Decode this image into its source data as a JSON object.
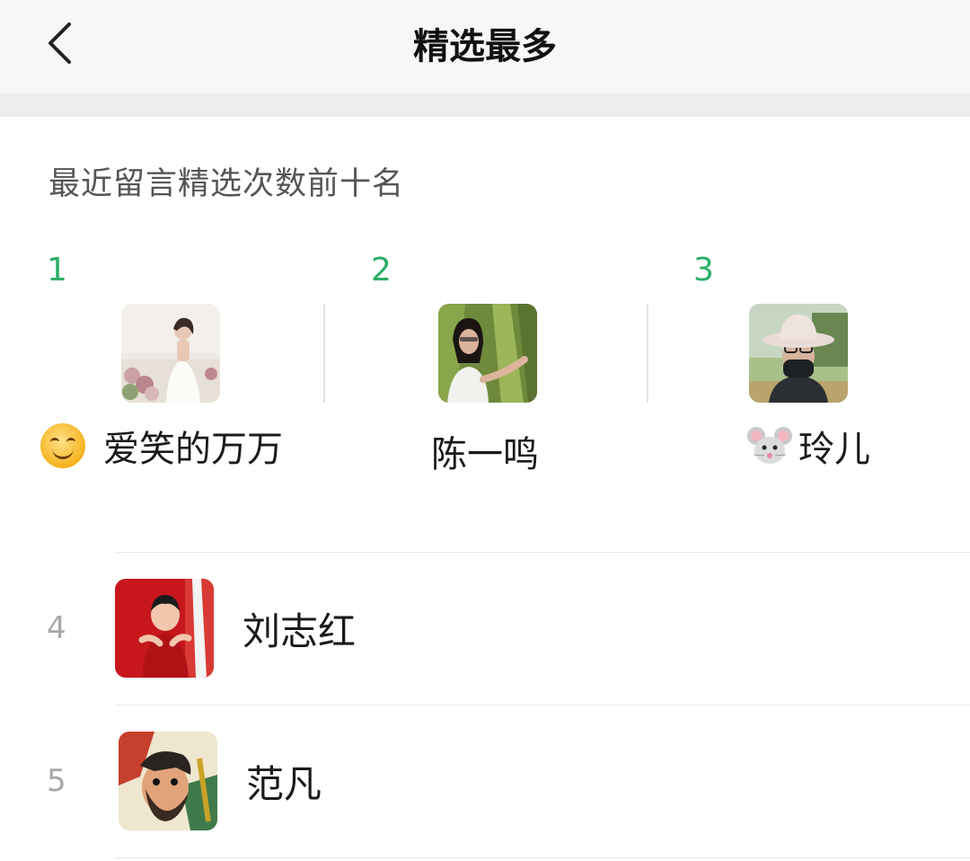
{
  "nav": {
    "title": "精选最多",
    "back_icon": "chevron-left-icon"
  },
  "subtitle": "最近留言精选次数前十名",
  "top3": [
    {
      "rank": "1",
      "name": "爱笑的万万",
      "emoji": "smiling-face-emoji"
    },
    {
      "rank": "2",
      "name": "陈一鸣"
    },
    {
      "rank": "3",
      "name": "玲儿",
      "emoji": "mouse-face-emoji"
    }
  ],
  "list": [
    {
      "rank": "4",
      "name": "刘志红"
    },
    {
      "rank": "5",
      "name": "范凡"
    }
  ],
  "colors": {
    "accent": "#2bae67",
    "rank_gray": "#a8a8a8",
    "nav_bg": "#f7f7f7",
    "gap_bg": "#ededed"
  }
}
